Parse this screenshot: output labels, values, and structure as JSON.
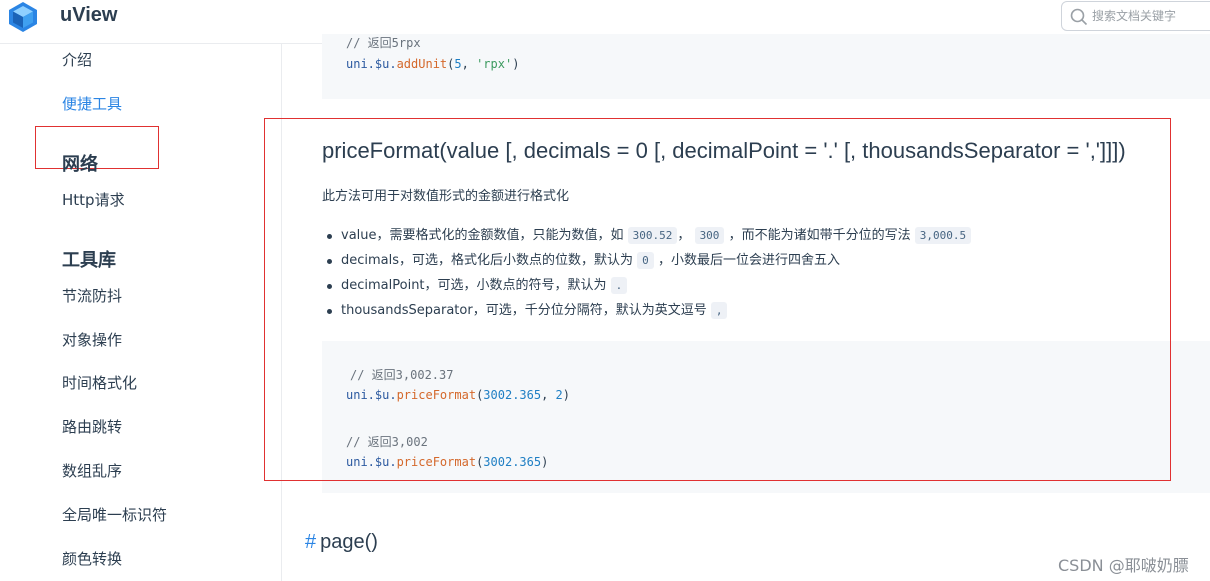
{
  "header": {
    "brand": "uView",
    "search_placeholder": "搜索文档关键字"
  },
  "sidebar": {
    "items_top": [
      "介绍",
      "便捷工具"
    ],
    "active_item": "便捷工具",
    "group_network": "网络",
    "network_items": [
      "Http请求"
    ],
    "group_tools": "工具库",
    "tools_items": [
      "节流防抖",
      "对象操作",
      "时间格式化",
      "路由跳转",
      "数组乱序",
      "全局唯一标识符",
      "颜色转换"
    ]
  },
  "code_top": {
    "comment": "// 返回5rpx",
    "line_obj": "uni.$u.",
    "line_fn": "addUnit",
    "line_open": "(",
    "line_num": "5",
    "line_sep": ", ",
    "line_str": "'rpx'",
    "line_close": ")"
  },
  "section": {
    "title": "priceFormat(value [, decimals = 0 [, decimalPoint = '.' [, thousandsSeparator = ',']]])",
    "description": "此方法可用于对数值形式的金额进行格式化",
    "params": [
      {
        "p1": "value，需要格式化的金额数值，只能为数值，如",
        "c1": "300.52",
        "p2": "，",
        "c2": "300",
        "p3": "，而不能为诸如带千分位的写法",
        "c3": "3,000.5"
      },
      {
        "p1": "decimals，可选，格式化后小数点的位数，默认为",
        "c1": "0",
        "p2": "，小数最后一位会进行四舍五入"
      },
      {
        "p1": "decimalPoint，可选，小数点的符号，默认为",
        "c1": "."
      },
      {
        "p1": "thousandsSeparator，可选，千分位分隔符，默认为英文逗号",
        "c1": ","
      }
    ]
  },
  "code_main": {
    "comment1": "// 返回3,002.37",
    "l1_obj": "uni.$u.",
    "l1_fn": "priceFormat",
    "l1_open": "(",
    "l1_num1": "3002.365",
    "l1_sep": ", ",
    "l1_num2": "2",
    "l1_close": ")",
    "comment2": "// 返回3,002",
    "l2_obj": "uni.$u.",
    "l2_fn": "priceFormat",
    "l2_open": "(",
    "l2_num1": "3002.365",
    "l2_close": ")"
  },
  "next_heading": {
    "anchor": "#",
    "title": "page()"
  },
  "watermark": "CSDN @耶啵奶膘",
  "colors": {
    "accent": "#2b85e4",
    "highlight_box": "#e03131",
    "code_bg": "#f6f8fa"
  }
}
